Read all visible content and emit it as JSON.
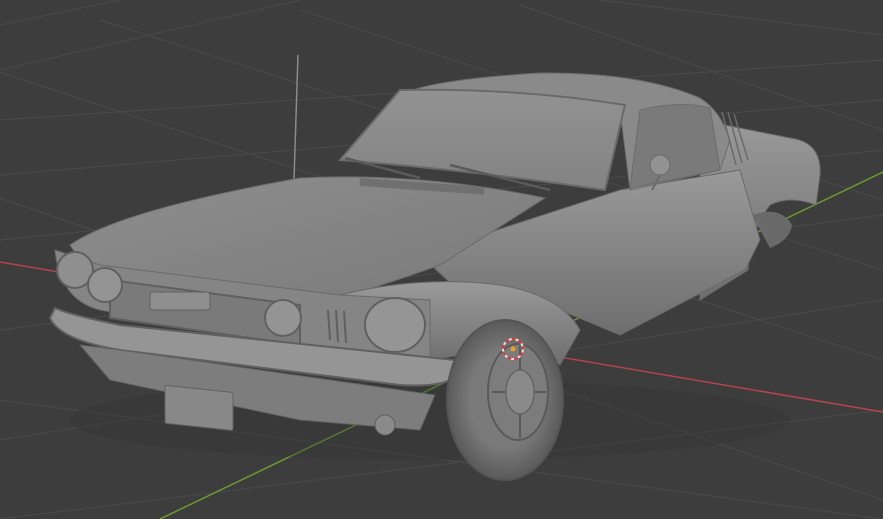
{
  "viewport": {
    "background_color": "#3d3d3d",
    "grid_line_color": "#4a4a4a",
    "x_axis_color": "#b5434d",
    "y_axis_color": "#6b9a2e",
    "show_grid": true,
    "show_axes": true
  },
  "scene": {
    "object_type": "car-model",
    "shading": "solid",
    "body_color": "#8c8c8c"
  },
  "origin_marker": {
    "icon": "3d-cursor-icon",
    "ring_colors": [
      "#e0e0e0",
      "#d93a3a"
    ],
    "center_color": "#f0a020"
  }
}
